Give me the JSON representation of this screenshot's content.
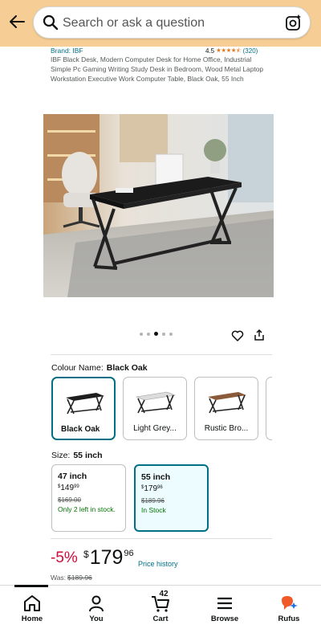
{
  "header": {
    "search_placeholder": "Search or ask a question",
    "back_icon": "back-arrow-icon",
    "search_icon": "search-icon",
    "lens_icon": "camera-lens-icon",
    "bg_color": "#f6cd94"
  },
  "product": {
    "brand": "Brand: IBF",
    "rating": "4.5",
    "review_count": "(320)",
    "title": "IBF Black Desk, Modern Computer Desk for Home Office, Industrial Simple Pc Gaming Writing Study Desk in Bedroom, Wood Metal Laptop Workstation Executive Work Computer Table, Black Oak, 55 Inch",
    "image_count": 5,
    "active_image_index": 2
  },
  "colour": {
    "label": "Colour Name:",
    "selected": "Black Oak",
    "options": [
      {
        "label": "Black Oak",
        "top_color": "#1e1e1e"
      },
      {
        "label": "Light Grey...",
        "top_color": "#dcdcdc"
      },
      {
        "label": "Rustic Bro...",
        "top_color": "#8a5a3a"
      }
    ]
  },
  "size": {
    "label": "Size:",
    "selected": "55 inch",
    "options": [
      {
        "name": "47 inch",
        "currency": "$",
        "price_whole": "149",
        "price_cents": "99",
        "was": "$169.00",
        "stock": "Only 2 left in stock."
      },
      {
        "name": "55 inch",
        "currency": "$",
        "price_whole": "179",
        "price_cents": "96",
        "was": "$189.96",
        "stock": "In Stock"
      }
    ]
  },
  "price": {
    "discount": "-5%",
    "currency": "$",
    "whole": "179",
    "cents": "96",
    "history_link": "Price history",
    "was_label": "Was:",
    "was_value": "$189.96"
  },
  "nav": {
    "items": [
      {
        "label": "Home",
        "icon": "home-icon"
      },
      {
        "label": "You",
        "icon": "user-icon"
      },
      {
        "label": "Cart",
        "icon": "cart-icon"
      },
      {
        "label": "Browse",
        "icon": "menu-icon"
      },
      {
        "label": "Rufus",
        "icon": "rufus-icon"
      }
    ],
    "cart_count": "42"
  }
}
